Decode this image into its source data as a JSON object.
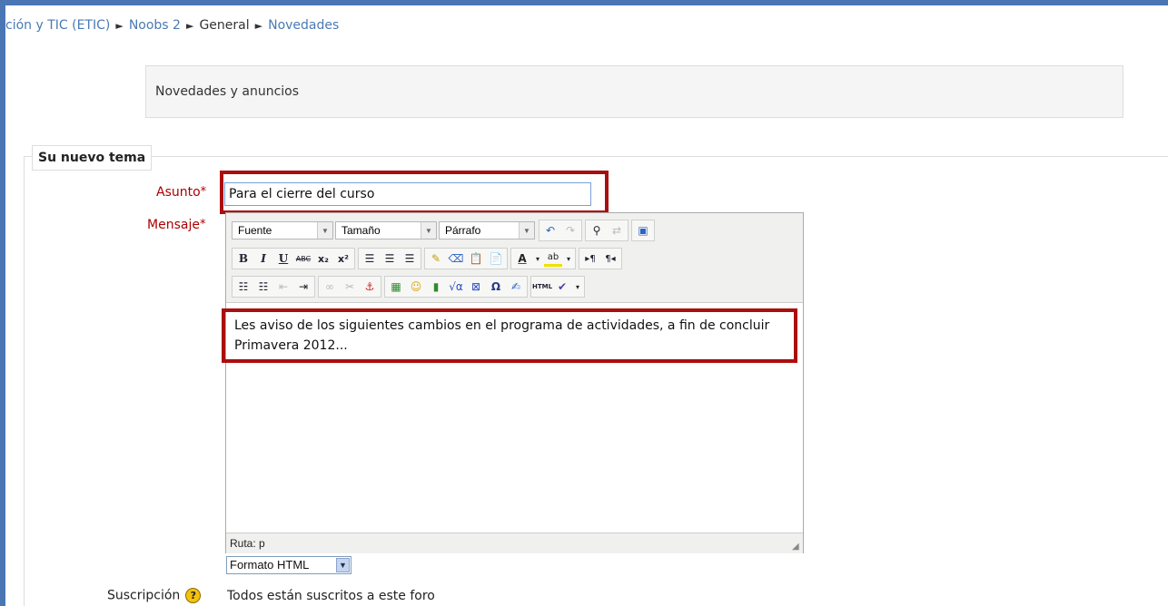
{
  "breadcrumb": {
    "items": [
      "ción y TIC (ETIC)",
      "Noobs 2",
      "General",
      "Novedades"
    ],
    "separator": "►"
  },
  "forum": {
    "intro": "Novedades y anuncios"
  },
  "form": {
    "legend": "Su nuevo tema",
    "subject_label": "Asunto",
    "subject_value": "Para el cierre del curso",
    "message_label": "Mensaje",
    "required_mark": "*",
    "message_text": "Les aviso de los siguientes cambios en el programa de actividades, a fin de concluir Primavera 2012...",
    "format_value": "Formato HTML",
    "subscription_label": "Suscripción",
    "subscription_value": "Todos están suscritos a este foro"
  },
  "editor": {
    "font_select": "Fuente",
    "size_select": "Tamaño",
    "paragraph_select": "Párrafo",
    "path_label": "Ruta: p"
  },
  "colors": {
    "accent": "#4a77b4",
    "link": "#4a7ab4",
    "required": "#aa0000",
    "highlight_box": "#aa0f0f"
  }
}
